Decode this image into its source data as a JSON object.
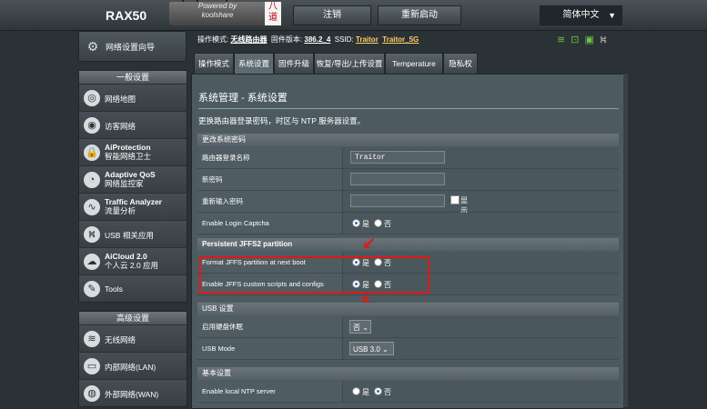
{
  "header": {
    "model": "RAX50",
    "powered_line1": "Powered by",
    "powered_line2": "koolshare",
    "logo_text": "八道",
    "logout": "注销",
    "reboot": "重新启动",
    "language": "简体中文"
  },
  "sidebar": {
    "quick_setup": "网络设置向导",
    "general_head": "一般设置",
    "general_items": [
      {
        "label": "网络地图"
      },
      {
        "label": "访客网络"
      },
      {
        "title": "AiProtection",
        "sub": "智能网络卫士"
      },
      {
        "title": "Adaptive QoS",
        "sub": "网络监控家"
      },
      {
        "title": "Traffic Analyzer",
        "sub": "流量分析"
      },
      {
        "label": "USB 相关应用"
      },
      {
        "title": "AiCloud 2.0",
        "sub": "个人云 2.0 应用"
      },
      {
        "label": "Tools"
      }
    ],
    "advanced_head": "高级设置",
    "advanced_items": [
      {
        "label": "无线网络"
      },
      {
        "label": "内部网络(LAN)"
      },
      {
        "label": "外部网络(WAN)"
      }
    ]
  },
  "status": {
    "mode_label": "操作模式:",
    "mode_value": "无线路由器",
    "fw_label": "固件版本:",
    "fw_value": "386.2_4",
    "ssid_label": "SSID:",
    "ssid1": "Traitor",
    "ssid2": "Traitor_5G"
  },
  "tabs": [
    "操作模式",
    "系统设置",
    "固件升级",
    "恢复/导出/上传设置",
    "Temperature",
    "隐私权"
  ],
  "panel": {
    "title": "系统管理 - 系统设置",
    "desc": "更换路由器登录密码，时区与 NTP 服务器设置。",
    "sec_password": "更改系统密码",
    "row_login_name": "路由器登录名称",
    "login_name_value": "Traitor",
    "row_new_pw": "新密码",
    "row_retype": "重新输入密码",
    "show_pw": "显示密码",
    "row_captcha": "Enable Login Captcha",
    "yes": "是",
    "no": "否",
    "sec_jffs": "Persistent JFFS2 partition",
    "row_format_jffs": "Format JFFS partition at next boot",
    "row_custom_scripts": "Enable JFFS custom scripts and configs",
    "sec_usb": "USB 设置",
    "row_hdd_sleep": "启用硬盘休眠",
    "hdd_sleep_value": "否",
    "row_usb_mode": "USB Mode",
    "usb_mode_value": "USB 3.0",
    "sec_basic": "基本设置",
    "row_ntp": "Enable local NTP server"
  }
}
